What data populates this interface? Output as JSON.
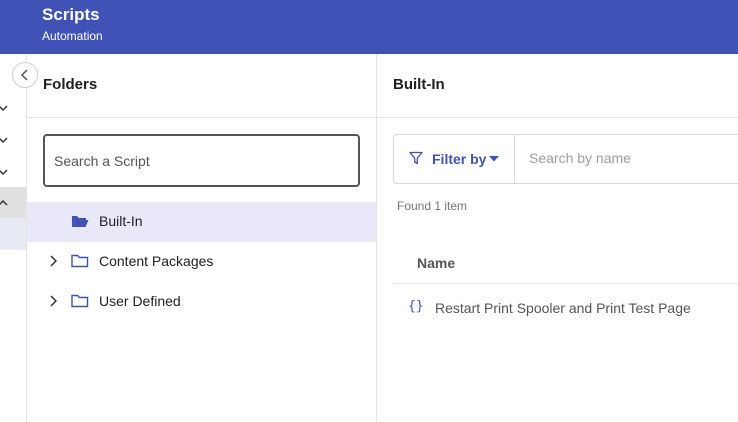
{
  "header": {
    "title": "Scripts",
    "subtitle": "Automation"
  },
  "folders_panel": {
    "title": "Folders",
    "search": {
      "placeholder": "Search a Script"
    },
    "tree": [
      {
        "label": "Built-In",
        "selected": true,
        "expandable": false,
        "folder_state": "open"
      },
      {
        "label": "Content Packages",
        "selected": false,
        "expandable": true,
        "folder_state": "closed"
      },
      {
        "label": "User Defined",
        "selected": false,
        "expandable": true,
        "folder_state": "closed"
      }
    ]
  },
  "content_panel": {
    "title": "Built-In",
    "filter": {
      "label": "Filter by",
      "search_placeholder": "Search by name"
    },
    "found_text": "Found 1 item",
    "columns": [
      "Name"
    ],
    "rows": [
      {
        "icon": "code-braces-icon",
        "name": "Restart Print Spooler and Print Test Page"
      }
    ]
  },
  "colors": {
    "brand": "#4052b5",
    "selected_row": "#e8e8f9"
  }
}
